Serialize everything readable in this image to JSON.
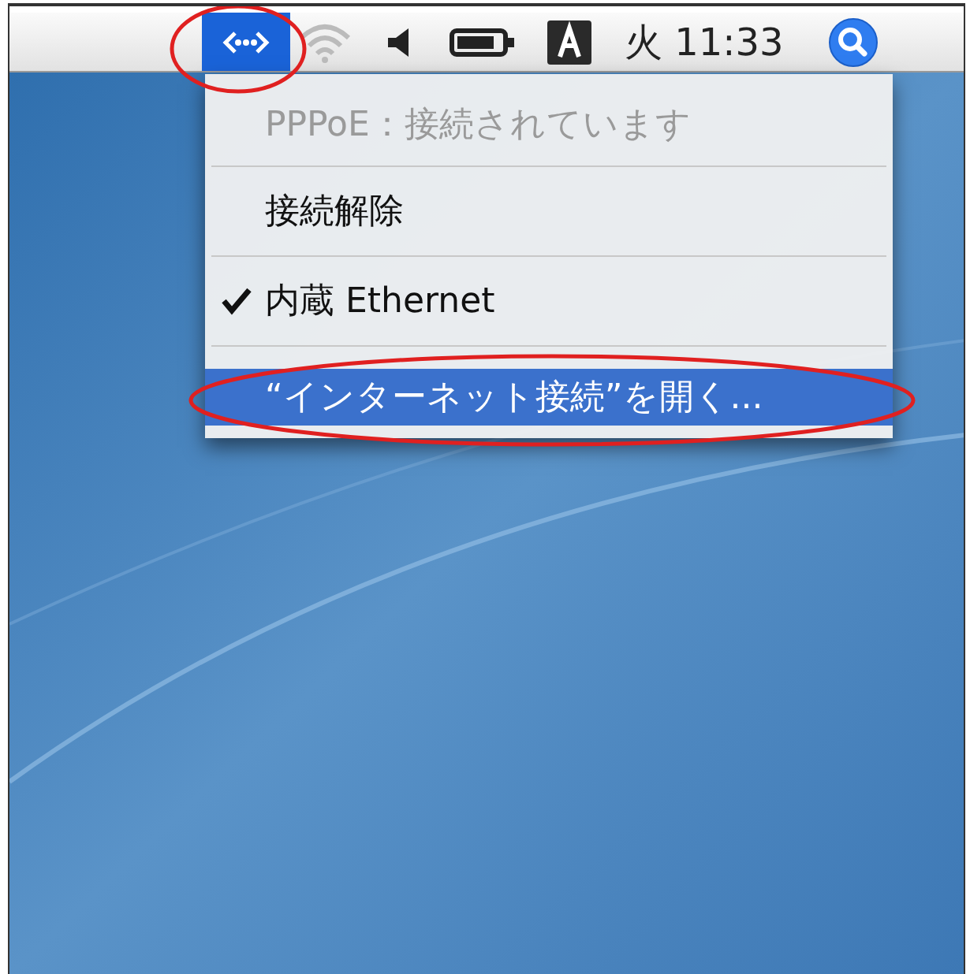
{
  "menu_bar": {
    "items": [
      {
        "kind": "network",
        "selected": true
      },
      {
        "kind": "wifi",
        "selected": false
      },
      {
        "kind": "volume",
        "selected": false
      },
      {
        "kind": "battery",
        "selected": false
      },
      {
        "kind": "input",
        "selected": false
      },
      {
        "kind": "clock",
        "text": "火 11:33",
        "selected": false
      },
      {
        "kind": "spotlight",
        "selected": false
      }
    ]
  },
  "menu": {
    "items": [
      {
        "label": "PPPoE：接続されています",
        "disabled": true,
        "checked": false,
        "selected": false
      },
      {
        "label": "接続解除",
        "disabled": false,
        "checked": false,
        "selected": false
      },
      {
        "label": "内蔵 Ethernet",
        "disabled": false,
        "checked": true,
        "selected": false
      },
      {
        "label": "“インターネット接続”を開く...",
        "disabled": false,
        "checked": false,
        "selected": true
      }
    ]
  }
}
